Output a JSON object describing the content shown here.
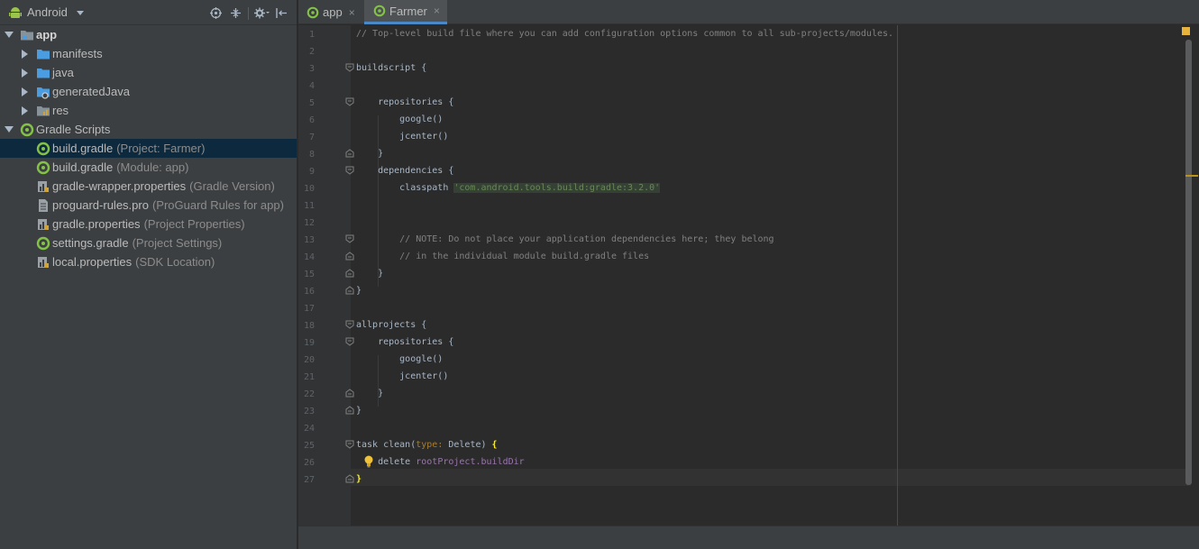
{
  "project_view": {
    "selector_label": "Android",
    "tools": [
      "locate-icon",
      "collapse-icon",
      "gear-icon",
      "hide-icon"
    ]
  },
  "tree": [
    {
      "label": "app",
      "hint": "",
      "expanded": true,
      "icon": "module-folder-icon"
    },
    {
      "label": "manifests",
      "hint": "",
      "icon": "folder-icon"
    },
    {
      "label": "java",
      "hint": "",
      "icon": "folder-icon"
    },
    {
      "label": "generatedJava",
      "hint": "",
      "icon": "generated-folder-icon"
    },
    {
      "label": "res",
      "hint": "",
      "icon": "res-folder-icon"
    },
    {
      "label": "Gradle Scripts",
      "hint": "",
      "expanded": true,
      "icon": "gradle-icon"
    },
    {
      "label": "build.gradle",
      "hint": "(Project: Farmer)",
      "icon": "gradle-icon"
    },
    {
      "label": "build.gradle",
      "hint": "(Module: app)",
      "icon": "gradle-icon"
    },
    {
      "label": "gradle-wrapper.properties",
      "hint": "(Gradle Version)",
      "icon": "properties-icon"
    },
    {
      "label": "proguard-rules.pro",
      "hint": "(ProGuard Rules for app)",
      "icon": "file-icon"
    },
    {
      "label": "gradle.properties",
      "hint": "(Project Properties)",
      "icon": "properties-icon"
    },
    {
      "label": "settings.gradle",
      "hint": "(Project Settings)",
      "icon": "gradle-icon"
    },
    {
      "label": "local.properties",
      "hint": "(SDK Location)",
      "icon": "properties-icon"
    }
  ],
  "tabs": [
    {
      "label": "app",
      "close": "×",
      "active": false
    },
    {
      "label": "Farmer",
      "close": "×",
      "active": true
    }
  ],
  "line_numbers": [
    "1",
    "2",
    "3",
    "4",
    "5",
    "6",
    "7",
    "8",
    "9",
    "10",
    "11",
    "12",
    "13",
    "14",
    "15",
    "16",
    "17",
    "18",
    "19",
    "20",
    "21",
    "22",
    "23",
    "24",
    "25",
    "26",
    "27"
  ],
  "code": {
    "l1": "// Top-level build file where you can add configuration options common to all sub-projects/modules.",
    "l3": "buildscript {",
    "l5": "    repositories {",
    "l6": "        google()",
    "l7": "        jcenter()",
    "l8": "    }",
    "l9": "    dependencies {",
    "l10_kw": "        classpath ",
    "l10_str": "'com.android.tools.build:gradle:3.2.0'",
    "l13": "        // NOTE: Do not place your application dependencies here; they belong",
    "l14": "        // in the individual module build.gradle files",
    "l15": "    }",
    "l16": "}",
    "l18": "allprojects {",
    "l19": "    repositories {",
    "l20": "        google()",
    "l21": "        jcenter()",
    "l22": "    }",
    "l23": "}",
    "l25_a": "task clean(",
    "l25_named": "type: ",
    "l25_b": "Delete) ",
    "l25_brace": "{",
    "l26_a": "    delete ",
    "l26_prop": "rootProject.buildDir",
    "l27_brace": "}"
  },
  "colors": {
    "selection": "#0d293e",
    "tab_underline": "#4a88c7",
    "string": "#6a8759",
    "comment": "#808080"
  }
}
